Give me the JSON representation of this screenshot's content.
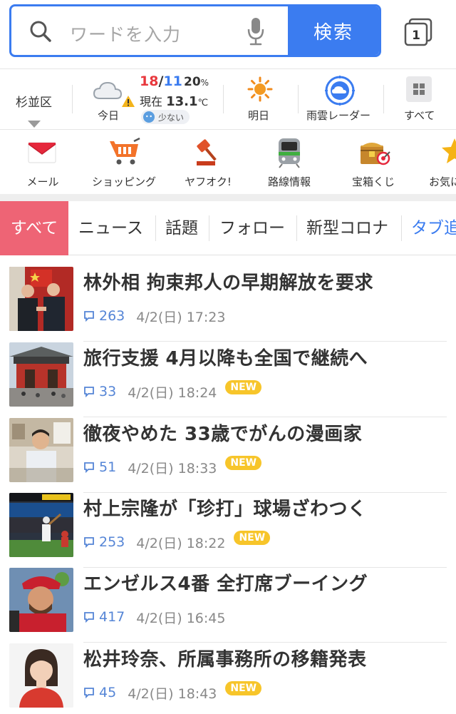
{
  "search": {
    "placeholder": "ワードを入力",
    "button_label": "検索",
    "tab_count": "1"
  },
  "weather": {
    "location": "杉並区",
    "today_label": "今日",
    "high": "18",
    "low": "11",
    "rain_percent": "20",
    "percent_unit": "%",
    "current_prefix": "現在",
    "current_temp": "13.1",
    "temp_unit": "℃",
    "pollen_label": "少ない",
    "tomorrow_label": "明日",
    "radar_label": "雨雲レーダー",
    "all_label": "すべて"
  },
  "services": [
    {
      "label": "メール",
      "icon": "mail-icon"
    },
    {
      "label": "ショッピング",
      "icon": "cart-icon"
    },
    {
      "label": "ヤフオク!",
      "icon": "auction-gavel-icon"
    },
    {
      "label": "路線情報",
      "icon": "train-icon"
    },
    {
      "label": "宝箱くじ",
      "icon": "treasure-box-icon"
    },
    {
      "label": "お気に",
      "icon": "star-icon"
    }
  ],
  "category_tabs": [
    {
      "label": "すべて",
      "active": true
    },
    {
      "label": "ニュース"
    },
    {
      "label": "話題"
    },
    {
      "label": "フォロー"
    },
    {
      "label": "新型コロナ"
    },
    {
      "label": "タブ追"
    }
  ],
  "news": [
    {
      "title": "林外相 拘束邦人の早期解放を要求",
      "comments": "263",
      "datetime": "4/2(日) 17:23",
      "badge": ""
    },
    {
      "title": "旅行支援 4月以降も全国で継続へ",
      "comments": "33",
      "datetime": "4/2(日) 18:24",
      "badge": "NEW"
    },
    {
      "title": "徹夜やめた 33歳でがんの漫画家",
      "comments": "51",
      "datetime": "4/2(日) 18:33",
      "badge": "NEW"
    },
    {
      "title": "村上宗隆が「珍打」球場ざわつく",
      "comments": "253",
      "datetime": "4/2(日) 18:22",
      "badge": "NEW"
    },
    {
      "title": "エンゼルス4番 全打席ブーイング",
      "comments": "417",
      "datetime": "4/2(日) 16:45",
      "badge": ""
    },
    {
      "title": "松井玲奈、所属事務所の移籍発表",
      "comments": "45",
      "datetime": "4/2(日) 18:43",
      "badge": "NEW"
    }
  ],
  "colors": {
    "accent_blue": "#3b7cf0",
    "active_tab": "#ee6475",
    "new_badge": "#f7c52a",
    "temp_high": "#e8383d",
    "temp_low": "#3b7cf0"
  }
}
